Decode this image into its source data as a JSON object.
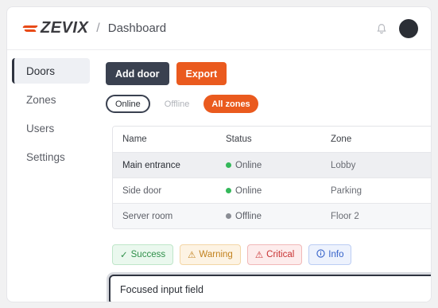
{
  "header": {
    "logo_text": "ZEVIX",
    "separator": "/",
    "breadcrumb": "Dashboard"
  },
  "sidebar": {
    "items": [
      {
        "label": "Doors",
        "active": true
      },
      {
        "label": "Zones",
        "active": false
      },
      {
        "label": "Users",
        "active": false
      },
      {
        "label": "Settings",
        "active": false
      }
    ]
  },
  "toolbar": {
    "add_label": "Add door",
    "export_label": "Export"
  },
  "filters": {
    "online": "Online",
    "offline": "Offline",
    "all": "All zones"
  },
  "table": {
    "columns": [
      "Name",
      "Status",
      "Zone"
    ],
    "rows": [
      {
        "name": "Main entrance",
        "status": "Online",
        "zone": "Lobby"
      },
      {
        "name": "Side door",
        "status": "Online",
        "zone": "Parking"
      },
      {
        "name": "Server room",
        "status": "Offline",
        "zone": "Floor 2"
      }
    ]
  },
  "badges": {
    "success": "Success",
    "warning": "Warning",
    "critical": "Critical",
    "info": "Info"
  },
  "input": {
    "value": "Focused input field"
  },
  "colors": {
    "accent": "#ea5a1e",
    "dark": "#3a4150",
    "online": "#34b85a",
    "offline": "#8a8d94"
  },
  "icons": {
    "bell": "bell-icon",
    "success": "check-icon",
    "warning": "warning-triangle-icon",
    "critical": "warning-triangle-icon",
    "info": "info-circle-icon"
  }
}
